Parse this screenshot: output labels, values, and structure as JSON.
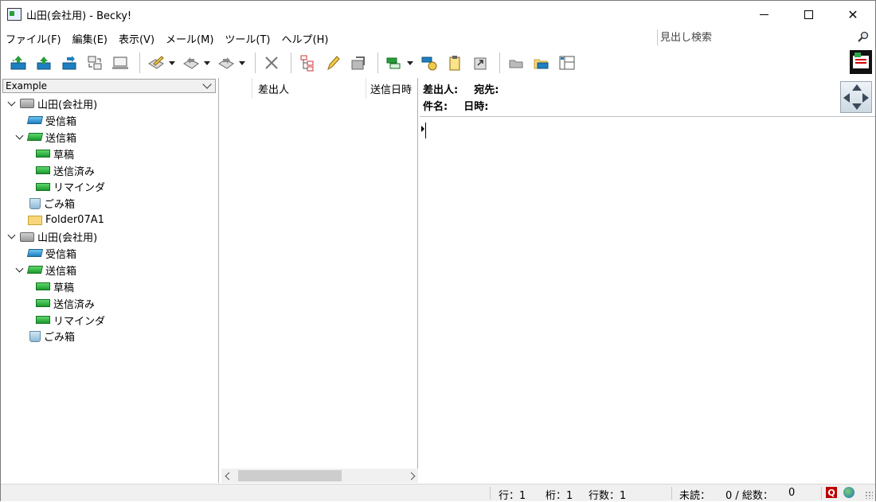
{
  "window": {
    "title": "山田(会社用) - Becky!",
    "controls": {
      "minimize": "",
      "maximize": "",
      "close": "✕"
    }
  },
  "menu": [
    "ファイル(F)",
    "編集(E)",
    "表示(V)",
    "メール(M)",
    "ツール(T)",
    "ヘルプ(H)"
  ],
  "search": {
    "placeholder": "見出し検索"
  },
  "toolbar": {
    "buttons": [
      "receive-all-icon",
      "receive-icon",
      "send-receive-icon",
      "sync-icon",
      "offline-icon",
      "compose-icon",
      "reply-icon",
      "forward-icon",
      "delete-icon",
      "thread-icon",
      "edit-icon",
      "move-icon",
      "filter-icon",
      "plugin-icon",
      "clipboard-icon",
      "export-icon",
      "folder-gray-icon",
      "folder-open-icon",
      "layout-icon"
    ]
  },
  "folder_pane": {
    "account_selector": "Example",
    "tree": [
      {
        "label": "山田(会社用)",
        "level": 0,
        "icon": "account-icon",
        "expanded": true
      },
      {
        "label": "受信箱",
        "level": 1,
        "icon": "inbox-icon"
      },
      {
        "label": "送信箱",
        "level": 1,
        "icon": "outbox-icon",
        "expanded": true
      },
      {
        "label": "草稿",
        "level": 2,
        "icon": "draft-icon"
      },
      {
        "label": "送信済み",
        "level": 2,
        "icon": "sent-icon"
      },
      {
        "label": "リマインダ",
        "level": 2,
        "icon": "reminder-icon"
      },
      {
        "label": "ごみ箱",
        "level": 1,
        "icon": "trash-icon"
      },
      {
        "label": "Folder07A1",
        "level": 1,
        "icon": "folder-icon"
      },
      {
        "label": "山田(会社用)",
        "level": 0,
        "icon": "account-icon",
        "expanded": true
      },
      {
        "label": "受信箱",
        "level": 1,
        "icon": "inbox-icon"
      },
      {
        "label": "送信箱",
        "level": 1,
        "icon": "outbox-icon",
        "expanded": true
      },
      {
        "label": "草稿",
        "level": 2,
        "icon": "draft-icon"
      },
      {
        "label": "送信済み",
        "level": 2,
        "icon": "sent-icon"
      },
      {
        "label": "リマインダ",
        "level": 2,
        "icon": "reminder-icon"
      },
      {
        "label": "ごみ箱",
        "level": 1,
        "icon": "trash-icon"
      }
    ]
  },
  "message_list": {
    "columns": [
      "差出人",
      "送信日時"
    ],
    "rows": []
  },
  "preview": {
    "from_label": "差出人:",
    "to_label": "宛先:",
    "subject_label": "件名:",
    "date_label": "日時:"
  },
  "status": {
    "line": "行：1",
    "column": "桁：1",
    "line_count": "行数：1",
    "unread_label": "未読：",
    "unread_total": "0 / 総数：",
    "total": "0"
  },
  "colors": {
    "accent_green": "#1c9a2e",
    "accent_blue": "#1e7fc0",
    "status_q": "#b00000"
  }
}
